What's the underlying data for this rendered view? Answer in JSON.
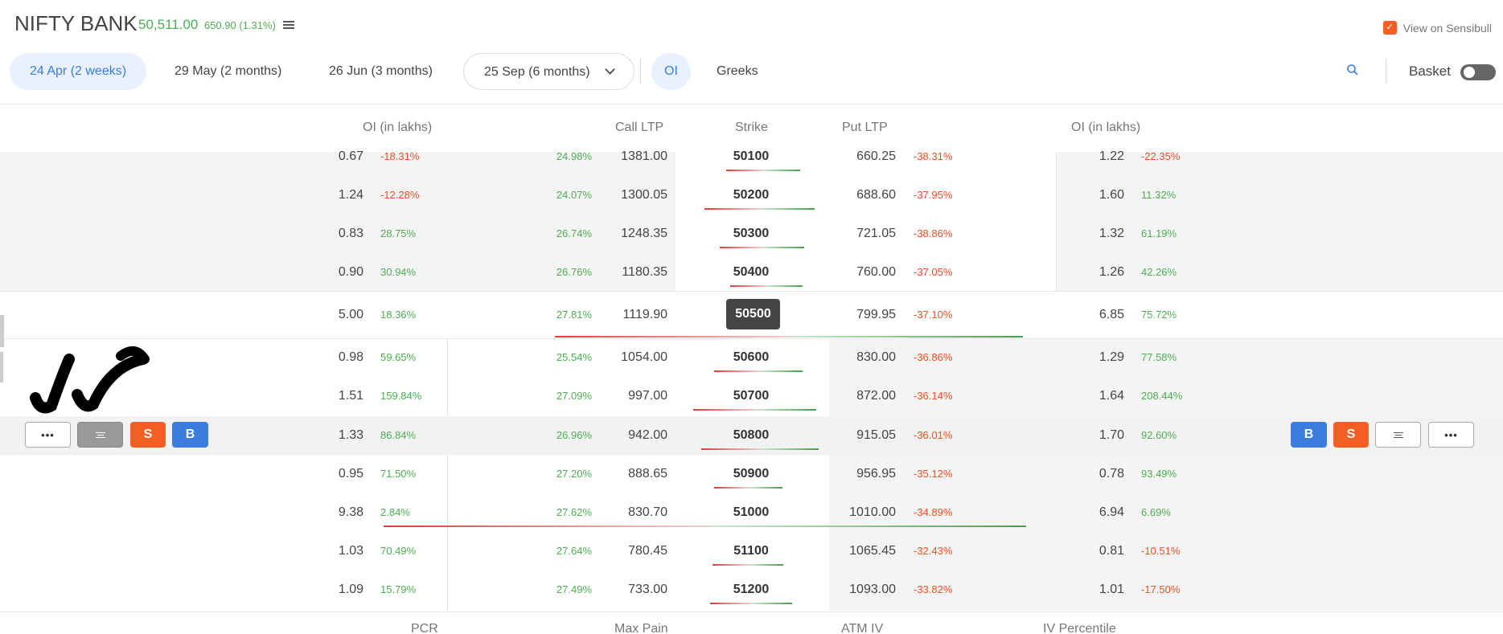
{
  "header": {
    "symbol": "NIFTY BANK",
    "price": "50,511.00",
    "change": "650.90 (1.31%)",
    "sensibull_link": "View on Sensibull"
  },
  "expiry_tabs": [
    {
      "label": "24 Apr (2 weeks)",
      "active": true
    },
    {
      "label": "29 May (2 months)",
      "active": false
    },
    {
      "label": "26 Jun (3 months)",
      "active": false
    }
  ],
  "expiry_select": {
    "value": "25 Sep (6 months)"
  },
  "view_tabs": [
    {
      "label": "OI",
      "active": true
    },
    {
      "label": "Greeks",
      "active": false
    }
  ],
  "basket_label": "Basket",
  "columns": {
    "call_oi": "OI (in lakhs)",
    "call_ltp": "Call LTP",
    "strike": "Strike",
    "put_ltp": "Put LTP",
    "put_oi": "OI (in lakhs)"
  },
  "rows": [
    {
      "call_oi": "0.67",
      "call_oi_chg": "-18.31%",
      "call_chg": "24.98%",
      "call_ltp": "1381.00",
      "strike": "50100",
      "put_ltp": "660.25",
      "put_chg": "-38.31%",
      "put_oi": "1.22",
      "put_oi_chg": "-22.35%"
    },
    {
      "call_oi": "1.24",
      "call_oi_chg": "-12.28%",
      "call_chg": "24.07%",
      "call_ltp": "1300.05",
      "strike": "50200",
      "put_ltp": "688.60",
      "put_chg": "-37.95%",
      "put_oi": "1.60",
      "put_oi_chg": "11.32%"
    },
    {
      "call_oi": "0.83",
      "call_oi_chg": "28.75%",
      "call_chg": "26.74%",
      "call_ltp": "1248.35",
      "strike": "50300",
      "put_ltp": "721.05",
      "put_chg": "-38.86%",
      "put_oi": "1.32",
      "put_oi_chg": "61.19%"
    },
    {
      "call_oi": "0.90",
      "call_oi_chg": "30.94%",
      "call_chg": "26.76%",
      "call_ltp": "1180.35",
      "strike": "50400",
      "put_ltp": "760.00",
      "put_chg": "-37.05%",
      "put_oi": "1.26",
      "put_oi_chg": "42.26%"
    },
    {
      "call_oi": "5.00",
      "call_oi_chg": "18.36%",
      "call_chg": "27.81%",
      "call_ltp": "1119.90",
      "strike": "50500",
      "put_ltp": "799.95",
      "put_chg": "-37.10%",
      "put_oi": "6.85",
      "put_oi_chg": "75.72%"
    },
    {
      "call_oi": "0.98",
      "call_oi_chg": "59.65%",
      "call_chg": "25.54%",
      "call_ltp": "1054.00",
      "strike": "50600",
      "put_ltp": "830.00",
      "put_chg": "-36.86%",
      "put_oi": "1.29",
      "put_oi_chg": "77.58%"
    },
    {
      "call_oi": "1.51",
      "call_oi_chg": "159.84%",
      "call_chg": "27.09%",
      "call_ltp": "997.00",
      "strike": "50700",
      "put_ltp": "872.00",
      "put_chg": "-36.14%",
      "put_oi": "1.64",
      "put_oi_chg": "208.44%"
    },
    {
      "call_oi": "1.33",
      "call_oi_chg": "86.84%",
      "call_chg": "26.96%",
      "call_ltp": "942.00",
      "strike": "50800",
      "put_ltp": "915.05",
      "put_chg": "-36.01%",
      "put_oi": "1.70",
      "put_oi_chg": "92.60%"
    },
    {
      "call_oi": "0.95",
      "call_oi_chg": "71.50%",
      "call_chg": "27.20%",
      "call_ltp": "888.65",
      "strike": "50900",
      "put_ltp": "956.95",
      "put_chg": "-35.12%",
      "put_oi": "0.78",
      "put_oi_chg": "93.49%"
    },
    {
      "call_oi": "9.38",
      "call_oi_chg": "2.84%",
      "call_chg": "27.62%",
      "call_ltp": "830.70",
      "strike": "51000",
      "put_ltp": "1010.00",
      "put_chg": "-34.89%",
      "put_oi": "6.94",
      "put_oi_chg": "6.69%"
    },
    {
      "call_oi": "1.03",
      "call_oi_chg": "70.49%",
      "call_chg": "27.64%",
      "call_ltp": "780.45",
      "strike": "51100",
      "put_ltp": "1065.45",
      "put_chg": "-32.43%",
      "put_oi": "0.81",
      "put_oi_chg": "-10.51%"
    },
    {
      "call_oi": "1.09",
      "call_oi_chg": "15.79%",
      "call_chg": "27.49%",
      "call_ltp": "733.00",
      "strike": "51200",
      "put_ltp": "1093.00",
      "put_chg": "-33.82%",
      "put_oi": "1.01",
      "put_oi_chg": "-17.50%"
    }
  ],
  "row_actions": {
    "buy": "B",
    "sell": "S",
    "more": "•••"
  },
  "footer": {
    "pcr": "PCR",
    "max_pain": "Max Pain",
    "atm_iv": "ATM IV",
    "iv_percentile": "IV Percentile"
  },
  "colors": {
    "green": "#4caf50",
    "red": "#f25022",
    "accent": "#3b7ddd",
    "sell": "#f35f24"
  }
}
